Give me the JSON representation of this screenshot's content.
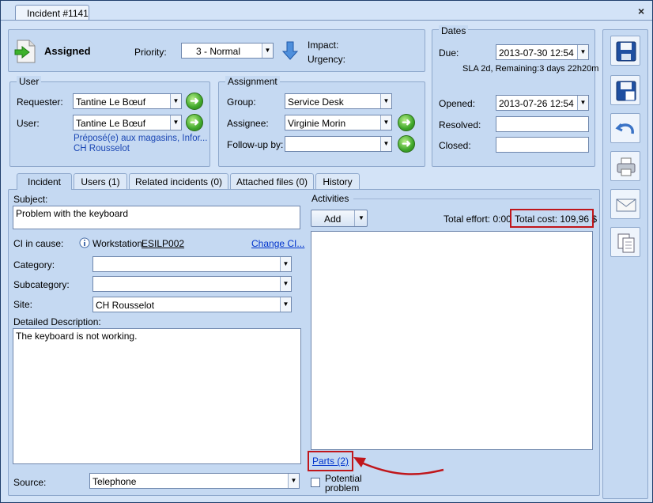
{
  "window": {
    "tab_title": "Incident #1141",
    "close": "×"
  },
  "status": {
    "label": "Assigned"
  },
  "priority": {
    "label": "Priority:",
    "value": "3 - Normal"
  },
  "impact": {
    "label": "Impact:"
  },
  "urgency": {
    "label": "Urgency:"
  },
  "user_group": {
    "title": "User",
    "requester_label": "Requester:",
    "requester_value": "Tantine Le Bœuf",
    "user_label": "User:",
    "user_value": "Tantine Le Bœuf",
    "info_line1": "Préposé(e) aux magasins, Infor...",
    "info_line2": "CH Rousselot"
  },
  "assignment_group": {
    "title": "Assignment",
    "group_label": "Group:",
    "group_value": "Service Desk",
    "assignee_label": "Assignee:",
    "assignee_value": "Virginie Morin",
    "followup_label": "Follow-up by:",
    "followup_value": ""
  },
  "dates_group": {
    "title": "Dates",
    "due_label": "Due:",
    "due_value": "2013-07-30 12:54",
    "sla_text": "SLA 2d, Remaining:3 days 22h20m",
    "opened_label": "Opened:",
    "opened_value": "2013-07-26 12:54",
    "resolved_label": "Resolved:",
    "resolved_value": "",
    "closed_label": "Closed:",
    "closed_value": ""
  },
  "tabs": [
    {
      "label": "Incident"
    },
    {
      "label": "Users (1)"
    },
    {
      "label": "Related incidents (0)"
    },
    {
      "label": "Attached files (0)"
    },
    {
      "label": "History"
    }
  ],
  "incident": {
    "subject_label": "Subject:",
    "subject_value": "Problem with the keyboard",
    "ci_label": "CI in cause:",
    "ci_type": "Workstation",
    "ci_name": "ESILP002",
    "change_ci": "Change CI...",
    "category_label": "Category:",
    "category_value": "",
    "subcategory_label": "Subcategory:",
    "subcategory_value": "",
    "site_label": "Site:",
    "site_value": "CH Rousselot",
    "description_label": "Detailed Description:",
    "description_value": "The keyboard is not working.",
    "source_label": "Source:",
    "source_value": "Telephone"
  },
  "activities": {
    "title": "Activities",
    "add_label": "Add",
    "total_effort": "Total effort: 0:00",
    "total_cost": "Total cost: 109,96 $",
    "parts_link": "Parts (2)",
    "potential_problem": "Potential problem"
  },
  "colors": {
    "accent_border": "#c0161b",
    "panel_bg": "#c5d9f2",
    "link": "#0033cc"
  }
}
